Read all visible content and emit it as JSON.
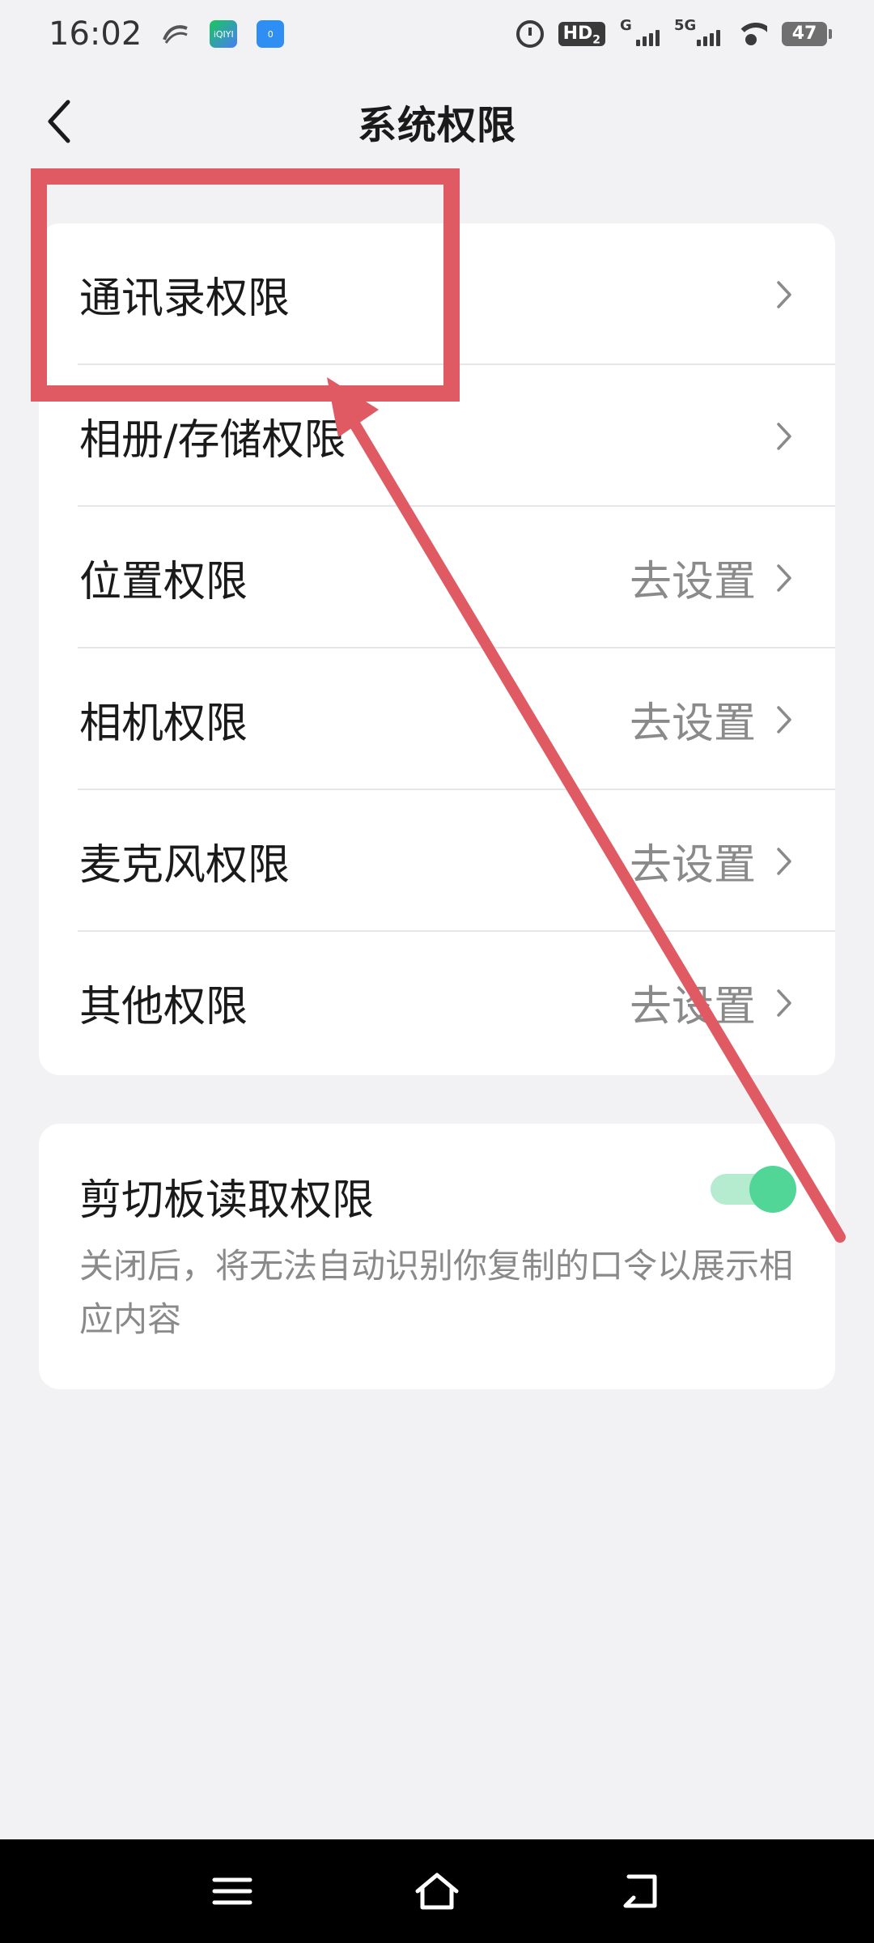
{
  "status_bar": {
    "time": "16:02",
    "link_icon": "link-icon",
    "app_badge_1": "iQIYI",
    "app_badge_2": "0",
    "hd_label": "HD",
    "hd_sub": "2",
    "signal_1_tag": "G",
    "signal_2_tag": "5G",
    "battery": "47"
  },
  "header": {
    "title": "系统权限"
  },
  "permissions": [
    {
      "label": "通讯录权限",
      "action": ""
    },
    {
      "label": "相册/存储权限",
      "action": ""
    },
    {
      "label": "位置权限",
      "action": "去设置"
    },
    {
      "label": "相机权限",
      "action": "去设置"
    },
    {
      "label": "麦克风权限",
      "action": "去设置"
    },
    {
      "label": "其他权限",
      "action": "去设置"
    }
  ],
  "clipboard": {
    "title": "剪切板读取权限",
    "description": "关闭后，将无法自动识别你复制的口令以展示相应内容",
    "enabled": true
  },
  "colors": {
    "annotation": "#e05a63",
    "toggle_on": "#52d698",
    "toggle_track": "#b5ecd0"
  }
}
